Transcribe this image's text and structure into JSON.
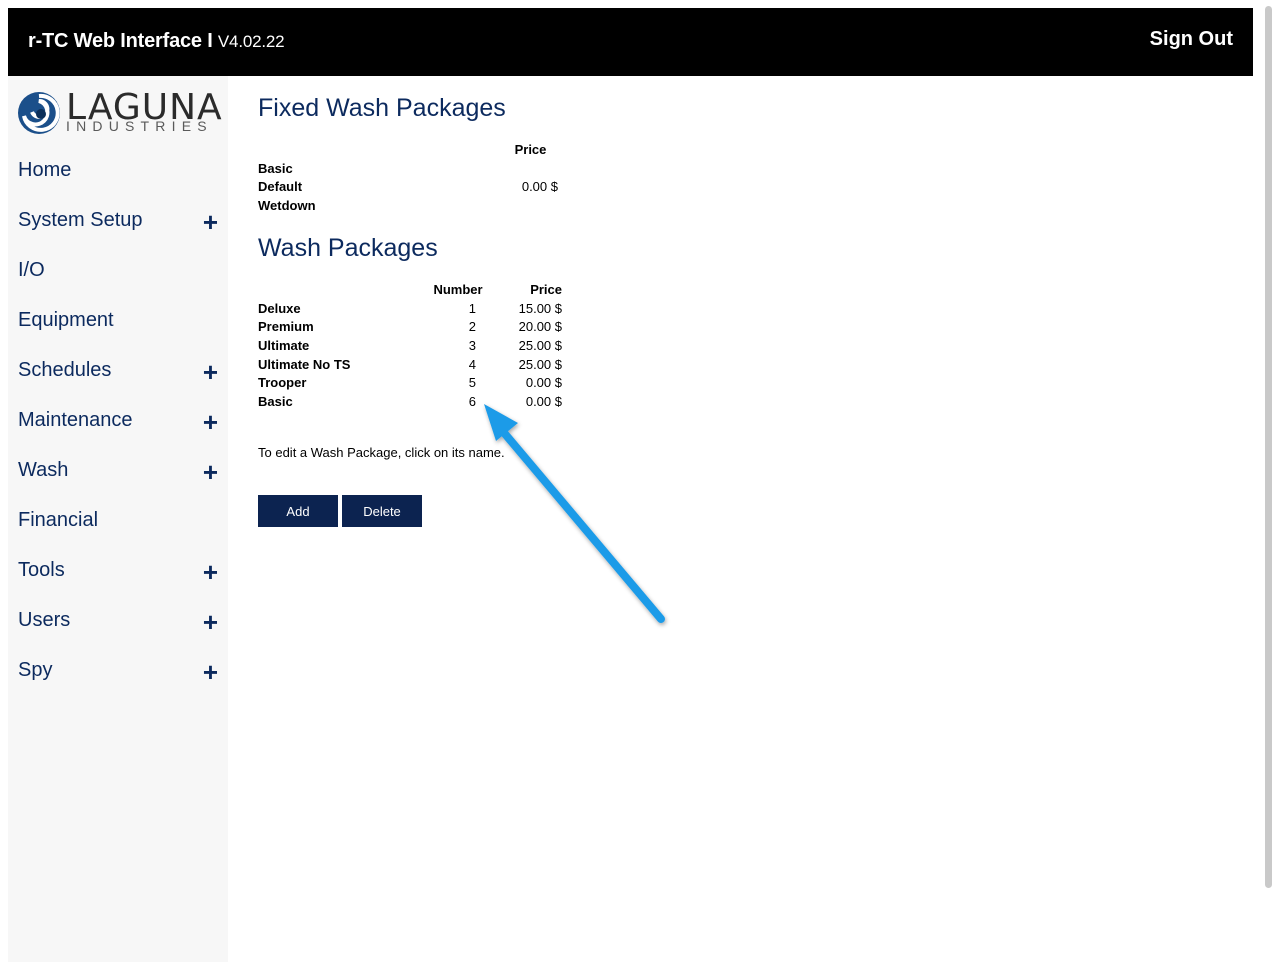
{
  "header": {
    "app_title": "r-TC Web Interface I",
    "version": "V4.02.22",
    "signout_label": "Sign Out"
  },
  "logo": {
    "brand": "LAGUNA",
    "sub": "INDUSTRIES"
  },
  "sidebar": {
    "items": [
      {
        "label": "Home",
        "expandable": false
      },
      {
        "label": "System Setup",
        "expandable": true
      },
      {
        "label": "I/O",
        "expandable": false
      },
      {
        "label": "Equipment",
        "expandable": false
      },
      {
        "label": "Schedules",
        "expandable": true
      },
      {
        "label": "Maintenance",
        "expandable": true
      },
      {
        "label": "Wash",
        "expandable": true
      },
      {
        "label": "Financial",
        "expandable": false
      },
      {
        "label": "Tools",
        "expandable": true
      },
      {
        "label": "Users",
        "expandable": true
      },
      {
        "label": "Spy",
        "expandable": true
      }
    ],
    "expand_glyph": "+"
  },
  "fixed": {
    "title": "Fixed Wash Packages",
    "price_header": "Price",
    "rows": [
      {
        "name": "Basic",
        "price": ""
      },
      {
        "name": "Default",
        "price": "0.00 $"
      },
      {
        "name": "Wetdown",
        "price": ""
      }
    ]
  },
  "wash": {
    "title": "Wash Packages",
    "number_header": "Number",
    "price_header": "Price",
    "rows": [
      {
        "name": "Deluxe",
        "number": "1",
        "price": "15.00 $"
      },
      {
        "name": "Premium",
        "number": "2",
        "price": "20.00 $"
      },
      {
        "name": "Ultimate",
        "number": "3",
        "price": "25.00 $"
      },
      {
        "name": "Ultimate No TS",
        "number": "4",
        "price": "25.00 $"
      },
      {
        "name": "Trooper",
        "number": "5",
        "price": "0.00 $"
      },
      {
        "name": "Basic",
        "number": "6",
        "price": "0.00 $"
      }
    ]
  },
  "note": "To edit a Wash Package, click on its name.",
  "buttons": {
    "add": "Add",
    "delete": "Delete"
  },
  "colors": {
    "accent": "#0c2a5e",
    "button": "#0c2350",
    "arrow": "#1f9be8"
  }
}
